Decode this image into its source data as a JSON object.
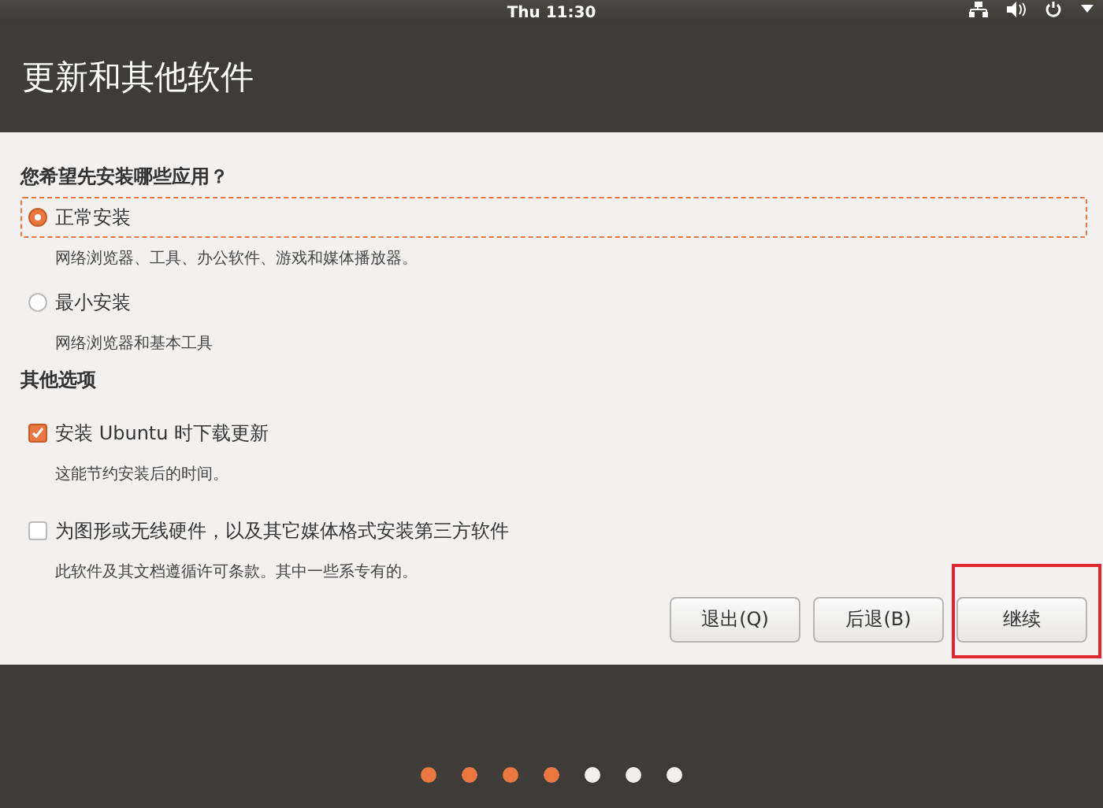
{
  "top_bar": {
    "clock": "Thu 11:30"
  },
  "header": {
    "title": "更新和其他软件"
  },
  "install_section": {
    "heading": "您希望先安装哪些应用？",
    "options": [
      {
        "label": "正常安装",
        "description": "网络浏览器、工具、办公软件、游戏和媒体播放器。",
        "selected": true,
        "focused": true
      },
      {
        "label": "最小安装",
        "description": "网络浏览器和基本工具",
        "selected": false,
        "focused": false
      }
    ]
  },
  "other_section": {
    "heading": "其他选项",
    "options": [
      {
        "label": "安装 Ubuntu 时下载更新",
        "description": "这能节约安装后的时间。",
        "checked": true
      },
      {
        "label": "为图形或无线硬件，以及其它媒体格式安装第三方软件",
        "description": "此软件及其文档遵循许可条款。其中一些系专有的。",
        "checked": false
      }
    ]
  },
  "buttons": [
    {
      "label": "退出(Q)",
      "highlighted": false
    },
    {
      "label": "后退(B)",
      "highlighted": false
    },
    {
      "label": "继续",
      "highlighted": true
    }
  ],
  "progress_steps": [
    {
      "done": true
    },
    {
      "done": true
    },
    {
      "done": true
    },
    {
      "done": true
    },
    {
      "done": false
    },
    {
      "done": false
    },
    {
      "done": false
    }
  ]
}
